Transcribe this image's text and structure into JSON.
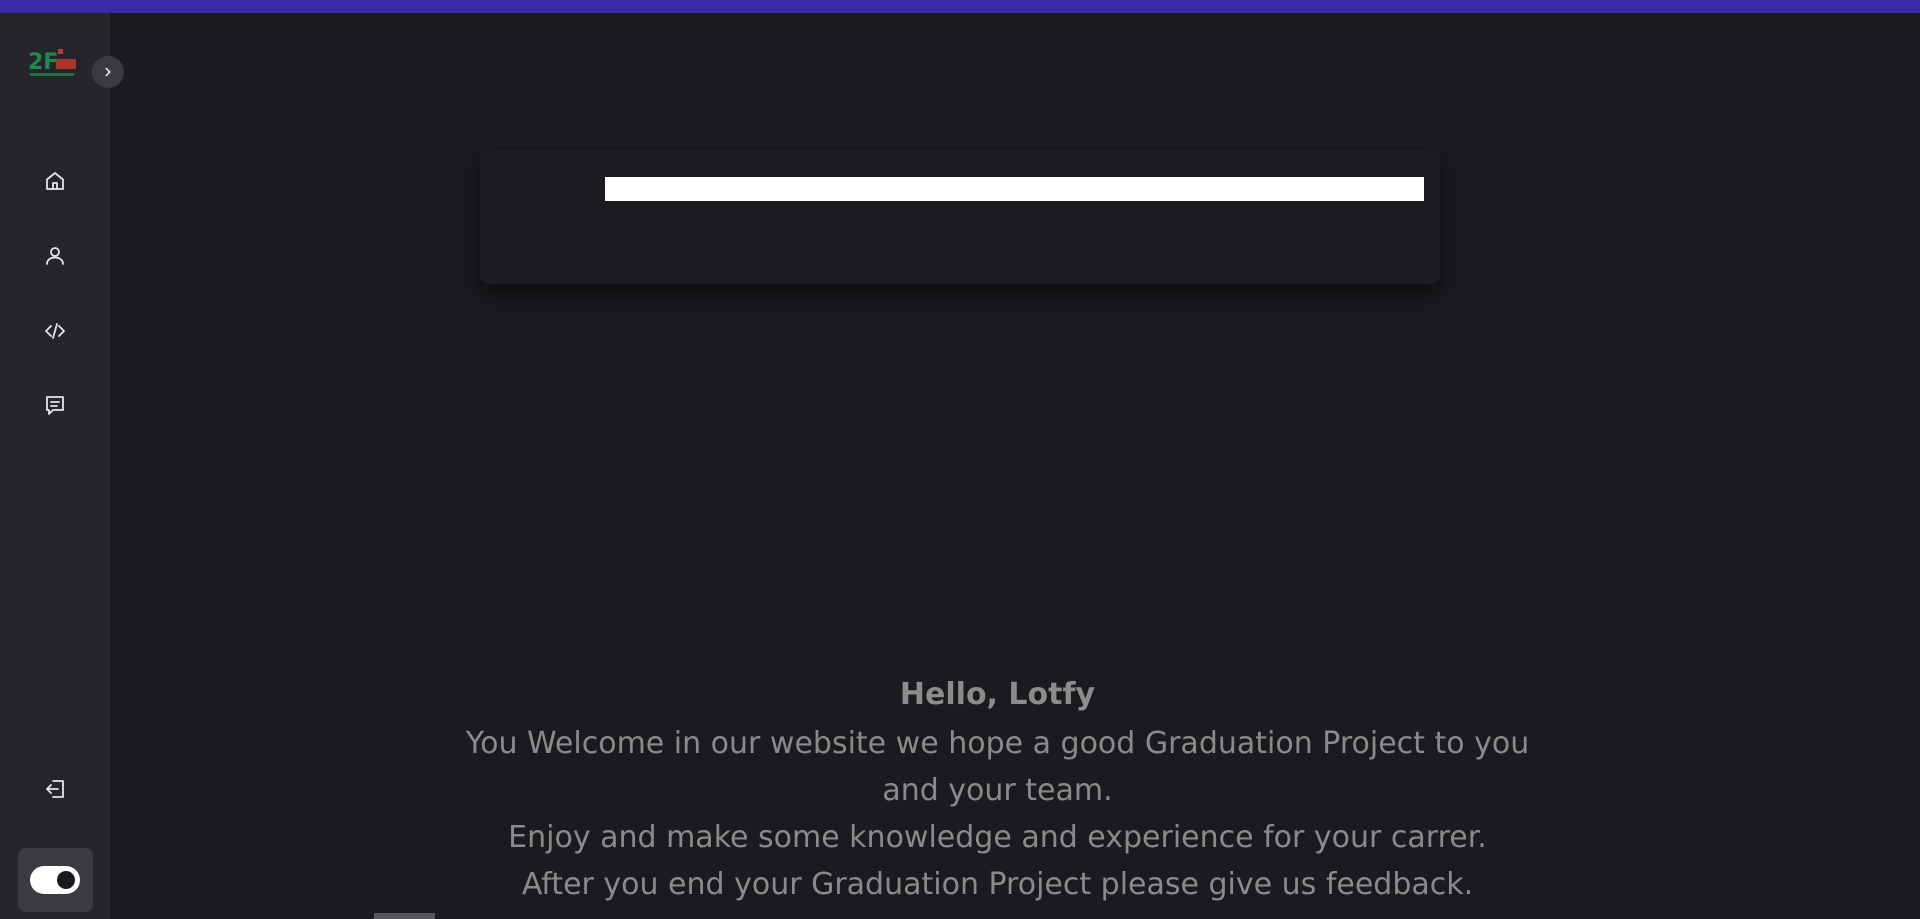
{
  "logo": {
    "text": "2F",
    "colors": {
      "primary": "#1f8a4c",
      "accent": "#c0392b"
    }
  },
  "sidebar": {
    "expand_icon": "chevron-right-icon",
    "items": [
      {
        "name": "home",
        "icon": "home-icon"
      },
      {
        "name": "profile",
        "icon": "user-icon"
      },
      {
        "name": "code",
        "icon": "code-icon"
      },
      {
        "name": "feedback",
        "icon": "message-icon"
      }
    ],
    "logout_icon": "logout-icon",
    "theme_toggle": {
      "state": "on"
    }
  },
  "welcome": {
    "greeting": "Hello, Lotfy",
    "message": "You Welcome in our website we hope a good Graduation Project to you and your team.",
    "line2": "Enjoy and make some knowledge and experience for your carrer.",
    "line3": "After you end your Graduation Project please give us feedback."
  },
  "theme": {
    "background": "#1a1b1e",
    "sidebar": "#25262b",
    "topbar": "#3b2aa8",
    "text_muted": "#8a8a8a"
  }
}
